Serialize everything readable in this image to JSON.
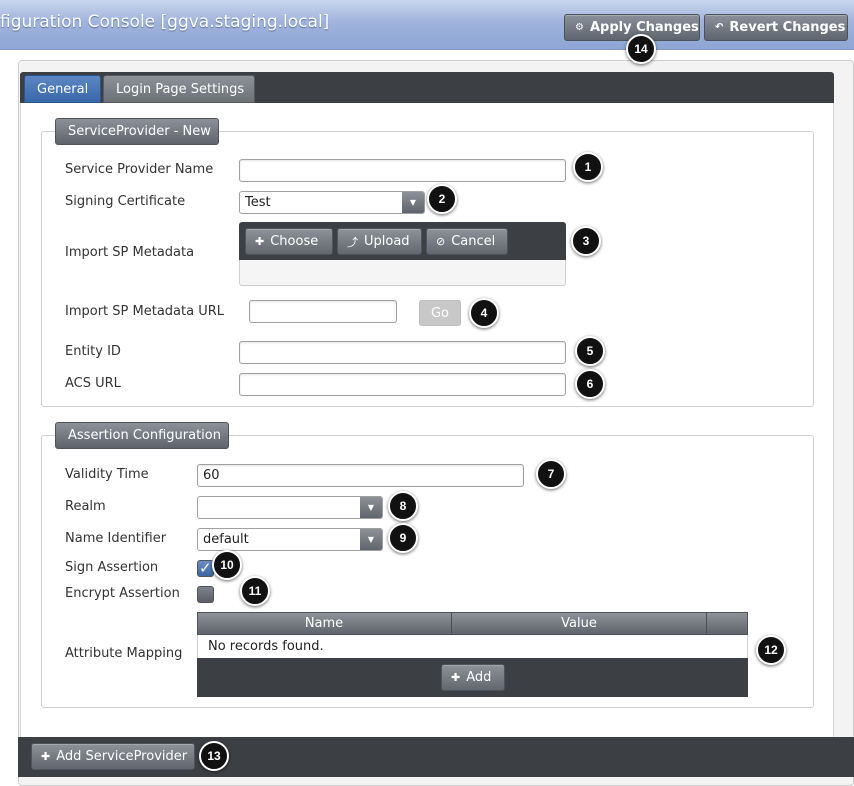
{
  "header": {
    "title": "figuration Console [ggva.staging.local]",
    "apply_label": "Apply Changes",
    "revert_label": "Revert Changes"
  },
  "tabs": [
    {
      "label": "General",
      "active": true
    },
    {
      "label": "Login Page Settings",
      "active": false
    }
  ],
  "service_provider": {
    "legend": "ServiceProvider - New",
    "name_label": "Service Provider Name",
    "name_value": "",
    "signing_label": "Signing Certificate",
    "signing_value": "Test",
    "import_label": "Import SP Metadata",
    "choose_label": "Choose",
    "upload_label": "Upload",
    "cancel_label": "Cancel",
    "import_url_label": "Import SP Metadata URL",
    "import_url_value": "",
    "go_label": "Go",
    "entity_label": "Entity ID",
    "entity_value": "",
    "acs_label": "ACS URL",
    "acs_value": ""
  },
  "assertion": {
    "legend": "Assertion Configuration",
    "validity_label": "Validity Time",
    "validity_value": "60",
    "realm_label": "Realm",
    "realm_value": "",
    "nameid_label": "Name Identifier",
    "nameid_value": "default",
    "sign_label": "Sign Assertion",
    "sign_checked": true,
    "encrypt_label": "Encrypt Assertion",
    "encrypt_checked": false,
    "attr_label": "Attribute Mapping",
    "columns": [
      "Name",
      "Value"
    ],
    "empty_text": "No records found.",
    "add_label": "Add"
  },
  "footer": {
    "add_sp_label": "Add ServiceProvider"
  },
  "callouts": [
    "1",
    "2",
    "3",
    "4",
    "5",
    "6",
    "7",
    "8",
    "9",
    "10",
    "11",
    "12",
    "13",
    "14"
  ]
}
